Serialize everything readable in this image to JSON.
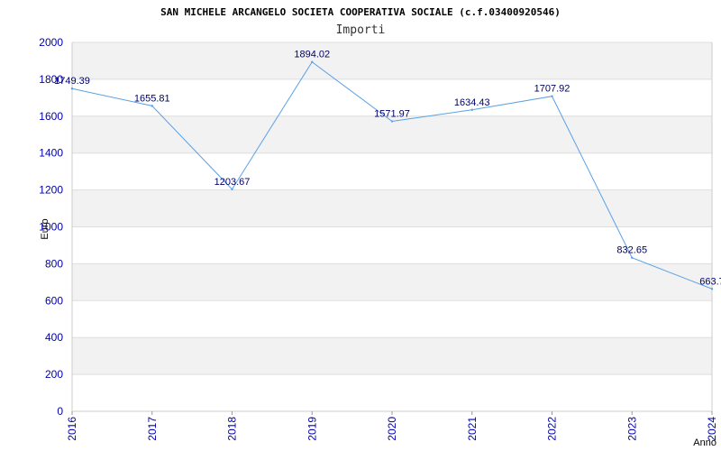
{
  "chart_data": {
    "type": "line",
    "title": "SAN MICHELE ARCANGELO SOCIETA COOPERATIVA SOCIALE (c.f.03400920546)",
    "subtitle": "Importi",
    "xlabel": "Anno",
    "ylabel": "Euro",
    "ylim": [
      0,
      2000
    ],
    "yticks": [
      "0",
      "200",
      "400",
      "600",
      "800",
      "1000",
      "1200",
      "1400",
      "1600",
      "1800",
      "2000"
    ],
    "categories": [
      "2016",
      "2017",
      "2018",
      "2019",
      "2020",
      "2021",
      "2022",
      "2023",
      "2024"
    ],
    "series": [
      {
        "values": [
          1749.39,
          1655.81,
          1203.67,
          1894.02,
          1571.97,
          1634.43,
          1707.92,
          832.65,
          663.7
        ],
        "labels": [
          "1749.39",
          "1655.81",
          "1203.67",
          "1894.02",
          "1571.97",
          "1634.43",
          "1707.92",
          "832.65",
          "663.7"
        ]
      }
    ],
    "grid": true,
    "colors": {
      "line": "#5aa0e6",
      "band": "#f2f2f2",
      "tick_text": "#0000aa",
      "label_text": "#000066"
    }
  }
}
